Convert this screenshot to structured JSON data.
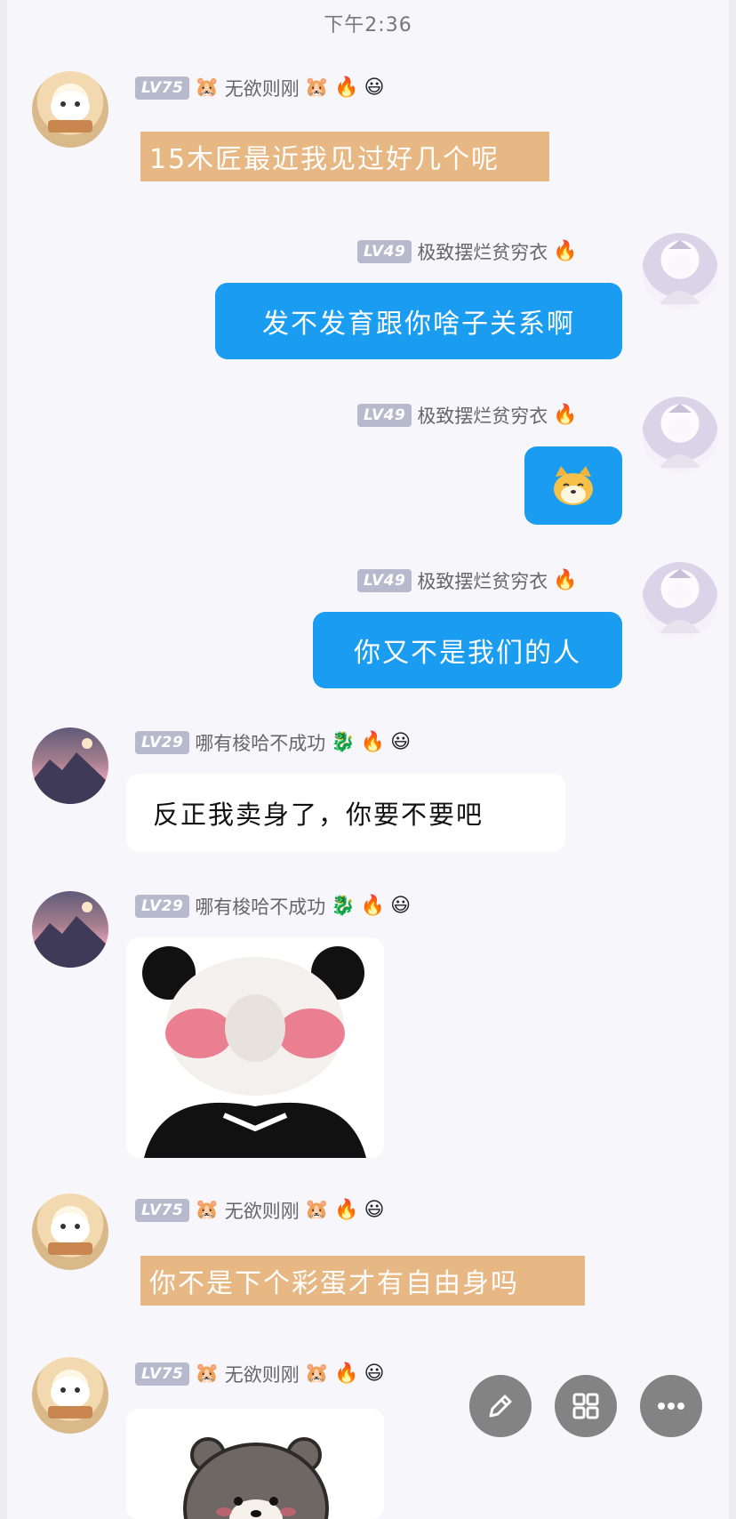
{
  "status": {
    "time": "下午2:36"
  },
  "users": {
    "a": {
      "level": "LV75",
      "name": "无欲则刚",
      "icons": [
        "🔥",
        "😃"
      ]
    },
    "b": {
      "level": "LV49",
      "name": "极致摆烂贫穷衣",
      "icons": [
        "🔥"
      ]
    },
    "c": {
      "level": "LV29",
      "name": "哪有梭哈不成功",
      "icons": [
        "🐉",
        "🔥",
        "😃"
      ]
    }
  },
  "messages": [
    {
      "sender": "a",
      "type": "text",
      "text": "15木匠最近我见过好几个呢"
    },
    {
      "sender": "b",
      "type": "text",
      "text": "发不发育跟你啥子关系啊"
    },
    {
      "sender": "b",
      "type": "sticker",
      "sticker": "dog-emoji"
    },
    {
      "sender": "b",
      "type": "text",
      "text": "你又不是我们的人"
    },
    {
      "sender": "c",
      "type": "text",
      "text": "反正我卖身了，你要不要吧"
    },
    {
      "sender": "c",
      "type": "sticker",
      "sticker": "panda-blush-meme"
    },
    {
      "sender": "a",
      "type": "text",
      "text": "你不是下个彩蛋才有自由身吗"
    },
    {
      "sender": "a",
      "type": "sticker",
      "sticker": "bear-meme"
    }
  ],
  "fab": {
    "edit": "pencil-icon",
    "grid": "grid-icon",
    "more": "more-icon"
  },
  "colors": {
    "self_bubble": "#1a9cf0",
    "tan_bubble": "#e7b884",
    "level_badge": "#b7b9cc"
  }
}
